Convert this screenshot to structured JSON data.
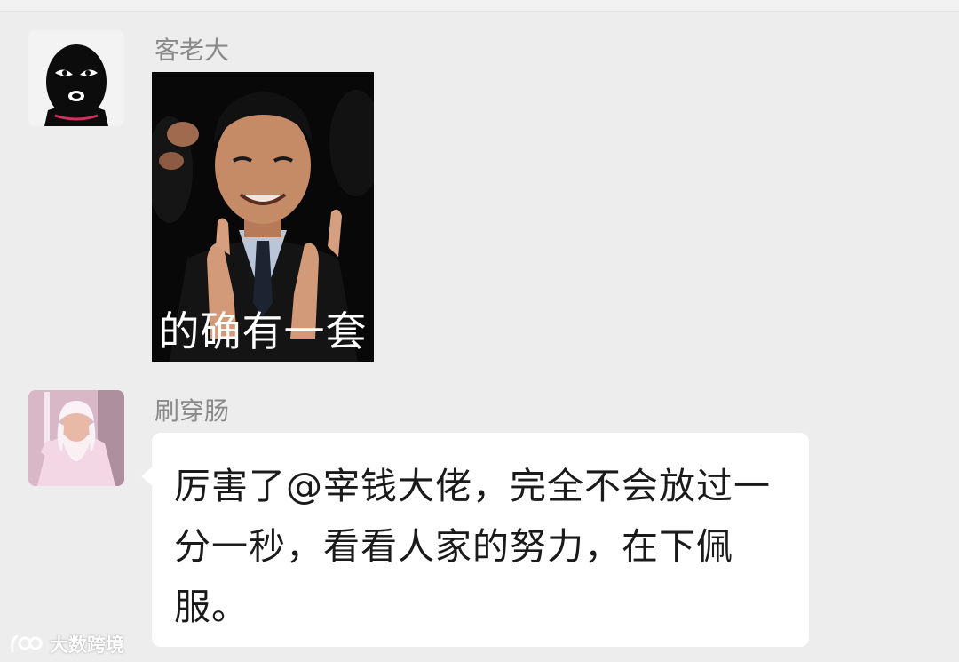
{
  "chat": {
    "messages": [
      {
        "sender": "客老大",
        "avatar_icon": "balaclava-avatar-icon",
        "type": "sticker",
        "sticker": {
          "caption": "的确有一套"
        }
      },
      {
        "sender": "刷穿肠",
        "avatar_icon": "wizard-avatar-icon",
        "type": "text",
        "text": "厉害了@宰钱大佬，完全不会放过一分一秒，看看人家的努力，在下佩服。"
      }
    ]
  },
  "watermark": {
    "logo_icon": "brand-logo-icon",
    "text": "大数跨境"
  },
  "colors": {
    "background": "#ededed",
    "bubble": "#ffffff",
    "sender_text": "#8a8a8a",
    "message_text": "#1a1a1a"
  }
}
